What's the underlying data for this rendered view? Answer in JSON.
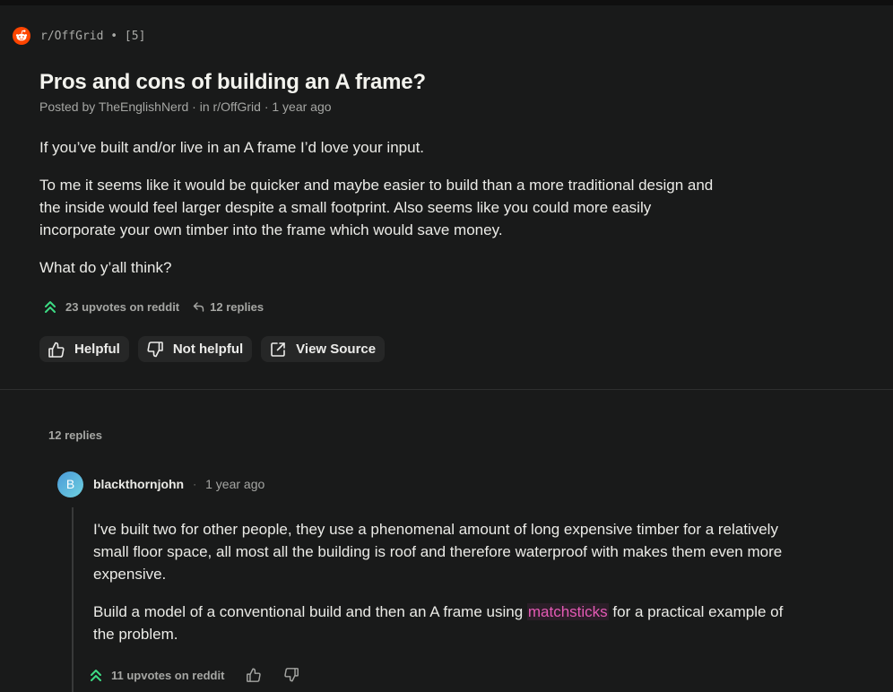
{
  "source": {
    "label": "r/OffGrid • [5]",
    "icon": "reddit-logo-icon",
    "brand_color": "#ff4500"
  },
  "post": {
    "title": "Pros and cons of building an A frame?",
    "meta": "Posted by TheEnglishNerd · in r/OffGrid · 1 year ago",
    "paragraphs": [
      "If you’ve built and/or live in an A frame I’d love your input.",
      "To me it seems like it would be quicker and maybe easier to build than a more traditional design and the inside would feel larger despite a small footprint. Also seems like you could more easily incorporate your own timber into the frame which would save money.",
      "What do y’all think?"
    ],
    "upvotes": "23 upvotes on reddit",
    "replies": "12 replies",
    "upvote_color": "#3ddc84"
  },
  "actions": {
    "helpful": "Helpful",
    "not_helpful": "Not helpful",
    "view_source": "View Source"
  },
  "thread": {
    "replies_count": "12 replies"
  },
  "comment": {
    "avatar_letter": "B",
    "author": "blackthornjohn",
    "separator": "·",
    "time": "1 year ago",
    "paragraph1": "I've built two for other people, they use a phenomenal amount of long expensive timber for a relatively small floor space, all most all the building is roof and therefore waterproof with makes them even more expensive.",
    "paragraph2_before": "Build a model of a conventional build and then an A frame using ",
    "paragraph2_highlight": "matchsticks",
    "paragraph2_after": " for a practical example of the problem.",
    "highlight_color": "#e55ab5",
    "upvotes": "11 upvotes on reddit"
  }
}
